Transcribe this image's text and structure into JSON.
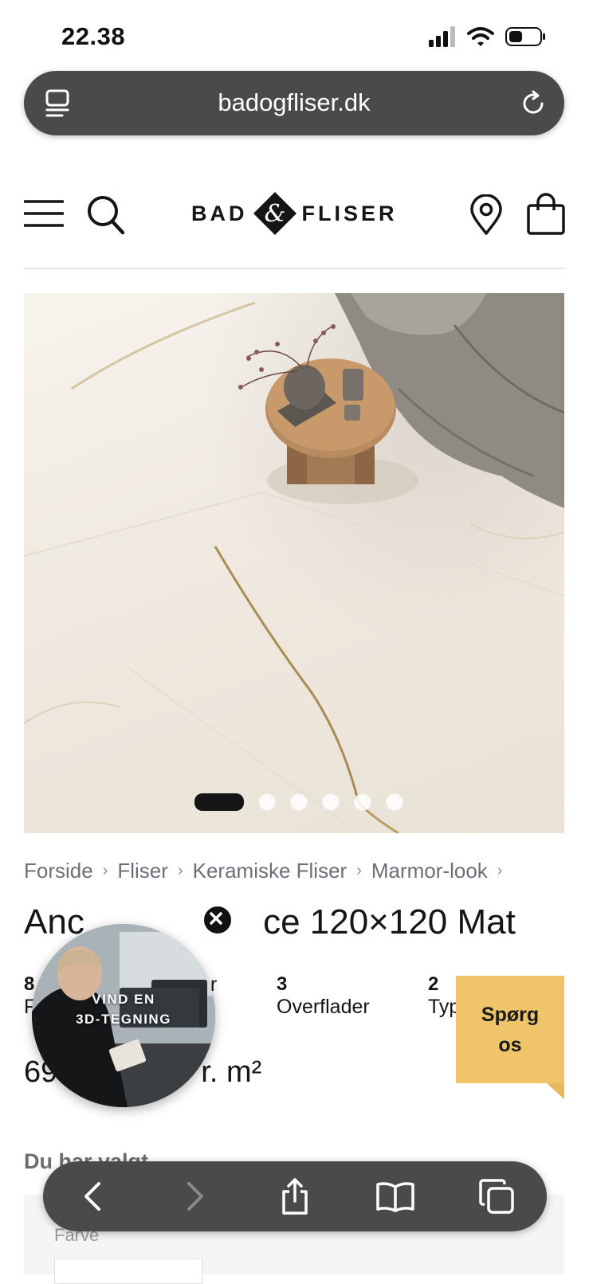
{
  "status_bar": {
    "time": "22.38"
  },
  "browser": {
    "url": "badogfliser.dk"
  },
  "header": {
    "logo_left": "BAD",
    "logo_mark": "&",
    "logo_right": "FLISER"
  },
  "gallery": {
    "slide_count": 6,
    "active_slide": 1
  },
  "breadcrumb": [
    "Forside",
    "Fliser",
    "Keramiske Fliser",
    "Marmor-look"
  ],
  "breadcrumb_separator": "›",
  "product": {
    "title_part1": "Anc",
    "title_part2": "O",
    "title_part3": "ce 120×120 Mat",
    "stats": [
      {
        "num": "8",
        "label": "F"
      },
      {
        "num": "",
        "label": "er"
      },
      {
        "num": "3",
        "label": "Overflader"
      },
      {
        "num": "2",
        "label": "Typ"
      }
    ],
    "price_left": "69",
    "price_right": "r. m²"
  },
  "chosen": {
    "title": "Du har valgt",
    "farve_label": "Farve"
  },
  "video_bubble": {
    "line1": "VIND EN",
    "line2": "3D-TEGNING"
  },
  "ask_button": {
    "line1": "Spørg",
    "line2": "os"
  },
  "colors": {
    "toolbar": "#4a4a4a",
    "accent": "#f0c56a",
    "text": "#151515"
  }
}
